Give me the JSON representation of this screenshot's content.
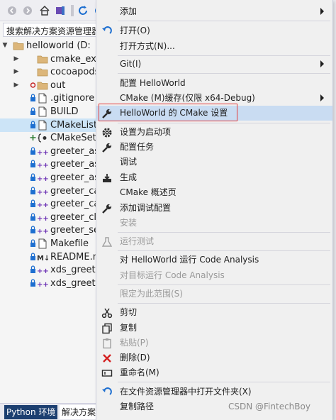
{
  "search": {
    "placeholder": "搜索解决方案资源管理器"
  },
  "tree": {
    "items": [
      {
        "label": "helloworld (D:",
        "icon": "folder-icon",
        "arrow": "▼",
        "depth": 0
      },
      {
        "label": "cmake_exte",
        "icon": "folder-icon",
        "arrow": "▶",
        "depth": 1
      },
      {
        "label": "cocoapods",
        "icon": "folder-icon",
        "arrow": "▶",
        "depth": 1
      },
      {
        "label": "out",
        "icon": "folder-icon",
        "arrow": "▶",
        "depth": 1
      },
      {
        "label": ".gitignore",
        "icon": "file-icon",
        "arrow": "",
        "depth": 1
      },
      {
        "label": "BUILD",
        "icon": "file-icon",
        "arrow": "",
        "depth": 1
      },
      {
        "label": "CMakeLists",
        "icon": "file-icon",
        "arrow": "",
        "depth": 1
      },
      {
        "label": "CMakeSett",
        "icon": "json-file-icon",
        "arrow": "",
        "depth": 1
      },
      {
        "label": "greeter_asy",
        "icon": "cpp-file-icon",
        "arrow": "",
        "depth": 1
      },
      {
        "label": "greeter_asy",
        "icon": "cpp-file-icon",
        "arrow": "",
        "depth": 1
      },
      {
        "label": "greeter_asy",
        "icon": "cpp-file-icon",
        "arrow": "",
        "depth": 1
      },
      {
        "label": "greeter_cal",
        "icon": "cpp-file-icon",
        "arrow": "",
        "depth": 1
      },
      {
        "label": "greeter_cal",
        "icon": "cpp-file-icon",
        "arrow": "",
        "depth": 1
      },
      {
        "label": "greeter_clie",
        "icon": "cpp-file-icon",
        "arrow": "",
        "depth": 1
      },
      {
        "label": "greeter_ser",
        "icon": "cpp-file-icon",
        "arrow": "",
        "depth": 1
      },
      {
        "label": "Makefile",
        "icon": "file-icon",
        "arrow": "",
        "depth": 1
      },
      {
        "label": "README.m",
        "icon": "markdown-file-icon",
        "arrow": "",
        "depth": 1
      },
      {
        "label": "xds_greete",
        "icon": "cpp-file-icon",
        "arrow": "",
        "depth": 1
      },
      {
        "label": "xds_greete",
        "icon": "cpp-file-icon",
        "arrow": "",
        "depth": 1
      }
    ]
  },
  "bottom_tabs": {
    "python_env": "Python 环境",
    "solution": "解决方案"
  },
  "menu": {
    "add": "添加",
    "open": "打开(O)",
    "open_with": "打开方式(N)...",
    "git": "Git(I)",
    "configure": "配置 HelloWorld",
    "cmake_cache": "CMake (M)缓存(仅限 x64-Debug)",
    "cmake_settings": "HelloWorld 的 CMake 设置",
    "set_startup": "设置为启动项",
    "config_tasks": "配置任务",
    "debug": "调试",
    "build": "生成",
    "cmake_overview": "CMake 概述页",
    "add_debug_config": "添加调试配置",
    "install": "安装",
    "run_tests": "运行测试",
    "code_analysis": "对 HelloWorld 运行 Code Analysis",
    "code_analysis_target": "对目标运行 Code Analysis",
    "limit_scope": "限定为此范围(S)",
    "cut": "剪切",
    "copy": "复制",
    "paste": "粘贴(P)",
    "delete": "删除(D)",
    "rename": "重命名(M)",
    "open_in_explorer": "在文件资源管理器中打开文件夹(X)",
    "copy_path": "复制路径"
  },
  "watermark": "CSDN @FintechBoy",
  "colors": {
    "accent": "#1c3f70",
    "highlight": "#c9dcf2",
    "red_box": "#e23b3b",
    "icon_blue": "#1e6fd0",
    "delete_red": "#d42020"
  }
}
